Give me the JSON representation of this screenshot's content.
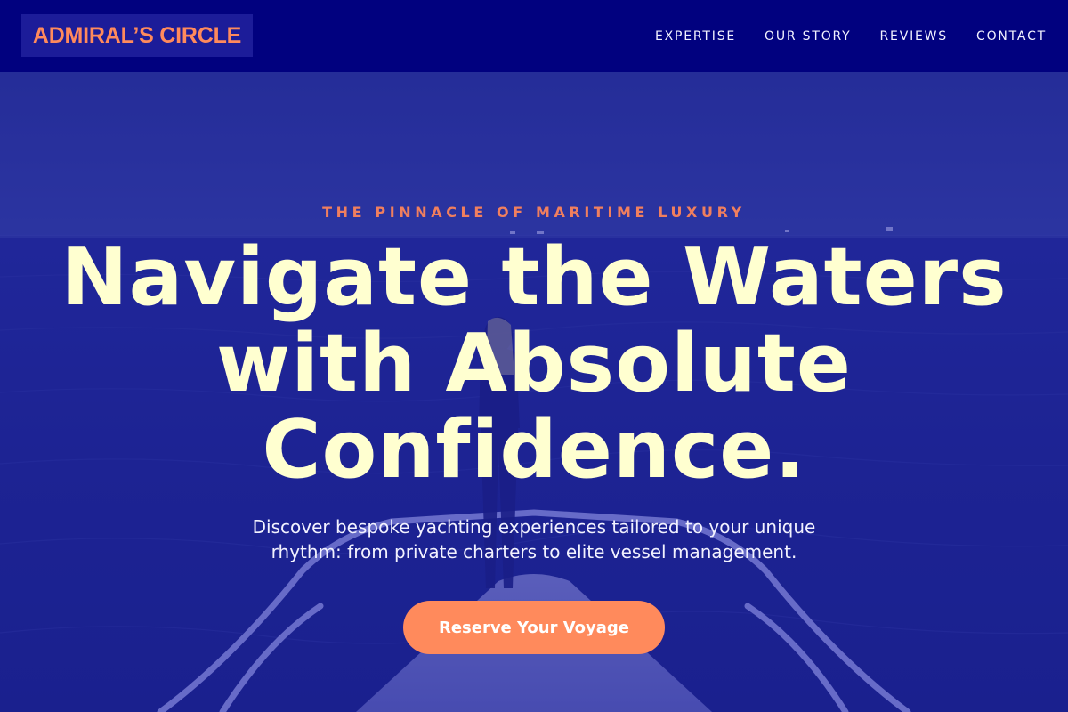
{
  "brand": {
    "logo_text": "ADMIRAL’S CIRCLE"
  },
  "nav": {
    "items": [
      {
        "label": "EXPERTISE"
      },
      {
        "label": "OUR STORY"
      },
      {
        "label": "REVIEWS"
      },
      {
        "label": "CONTACT"
      }
    ]
  },
  "hero": {
    "eyebrow": "THE PINNACLE OF MARITIME LUXURY",
    "headline_line1": "Navigate the Waters",
    "headline_line2": "with Absolute",
    "headline_line3": "Confidence.",
    "subtext_line1": "Discover bespoke yachting experiences tailored to your unique",
    "subtext_line2": "rhythm: from private charters to elite vessel management.",
    "cta_label": "Reserve Your Voyage"
  },
  "colors": {
    "header_bg": "#01017f",
    "accent": "#ff8a5c",
    "headline": "#ffffd0",
    "overlay": "#1a1a9a"
  }
}
